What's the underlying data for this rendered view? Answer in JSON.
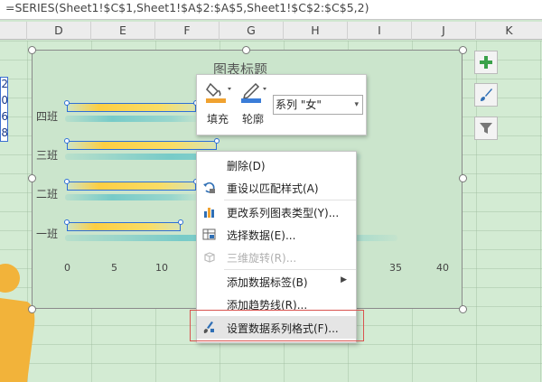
{
  "formula_bar": {
    "text": "=SERIES(Sheet1!$C$1,Sheet1!$A$2:$A$5,Sheet1!$C$2:$C$5,2)"
  },
  "columns": [
    "D",
    "E",
    "F",
    "G",
    "H",
    "I",
    "J",
    "K"
  ],
  "left_cells": [
    "2",
    "0",
    "6",
    "8"
  ],
  "chart": {
    "title": "图表标题",
    "categories": [
      "四班",
      "三班",
      "二班",
      "一班"
    ],
    "ticks": [
      "0",
      "5",
      "10",
      "35",
      "40"
    ]
  },
  "side_buttons": [
    "plus-icon",
    "brush-icon",
    "filter-icon"
  ],
  "mini_toolbar": {
    "fill_label": "填充",
    "outline_label": "轮廓",
    "series_select": "系列 \"女\""
  },
  "context_menu": {
    "items": [
      {
        "label": "删除(D)",
        "icon": "",
        "disabled": false
      },
      {
        "label": "重设以匹配样式(A)",
        "icon": "reset-icon",
        "disabled": false
      },
      {
        "label": "更改系列图表类型(Y)...",
        "icon": "bar-chart-icon",
        "disabled": false
      },
      {
        "label": "选择数据(E)...",
        "icon": "table-icon",
        "disabled": false
      },
      {
        "label": "三维旋转(R)...",
        "icon": "cube-icon",
        "disabled": true
      },
      {
        "label": "添加数据标签(B)",
        "icon": "",
        "disabled": false,
        "submenu": true
      },
      {
        "label": "添加趋势线(R)...",
        "icon": "",
        "disabled": false
      },
      {
        "label": "设置数据系列格式(F)...",
        "icon": "paint-icon",
        "disabled": false,
        "highlighted": true
      }
    ]
  },
  "colors": {
    "accent_selection": "#2d6fd8",
    "highlight_frame": "#d9534f",
    "fill_orange": "#f0a230",
    "outline_blue": "#3b7dd8"
  }
}
